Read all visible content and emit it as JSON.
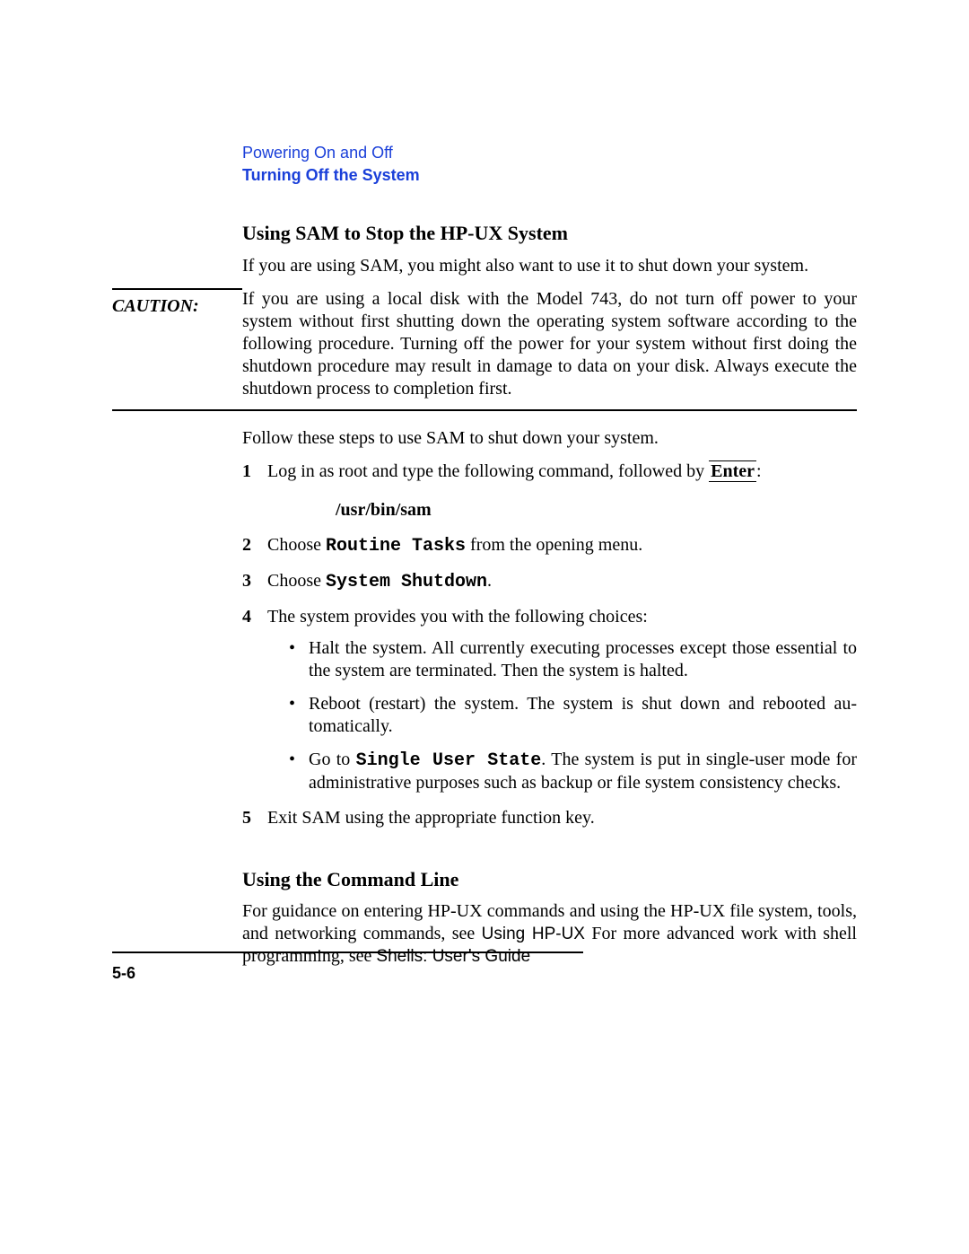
{
  "header": {
    "chapter": "Powering On and Off",
    "section": "Turning Off the System"
  },
  "s1": {
    "heading": "Using SAM to Stop the HP-UX System",
    "intro": "If you are using SAM, you might also want to use it to shut down your sys­tem.",
    "caution_label": "CAUTION:",
    "caution_body": "If you are using a local disk with the Model 743, do not turn off power to your system without first shutting down the operating system software according to the following procedure. Turning off the power for your system without first doing the shutdown procedure may result in damage to data on your disk. Always execute the shutdown process to completion first.",
    "follow": "Follow these steps to use SAM to shut down your system.",
    "steps": {
      "one_pre": "Log in as root and type the following command, followed by ",
      "one_key": "Enter",
      "one_post": ":",
      "one_cmd": "/usr/bin/sam",
      "two_pre": "Choose ",
      "two_cmd": "Routine Tasks",
      "two_post": " from the opening menu.",
      "three_pre": "Choose ",
      "three_cmd": "System Shutdown",
      "three_post": ".",
      "four": "The system provides you with the following choices:",
      "b1": "Halt the system. All currently executing processes except those essen­tial to the system are terminated. Then the system is halted.",
      "b2": "Reboot (restart) the system. The system is shut down and rebooted au­tomatically.",
      "b3_pre": "Go to ",
      "b3_cmd": "Single User State",
      "b3_post": ". The system is put in single-user mode for administrative purposes such as backup or file system consistency checks.",
      "five": "Exit SAM using the appropriate function key."
    }
  },
  "s2": {
    "heading": "Using the Command Line",
    "p_pre": "For guidance on entering HP-UX commands and using the HP-UX file sys­tem, tools, and networking commands, see ",
    "p_ref1": "Using HP-UX",
    "p_mid": " For more advanced work with shell programming, see ",
    "p_ref2_a": "Shells: User",
    "p_ref2_b": "s Guide"
  },
  "footer": {
    "pagenum": "5-6"
  }
}
